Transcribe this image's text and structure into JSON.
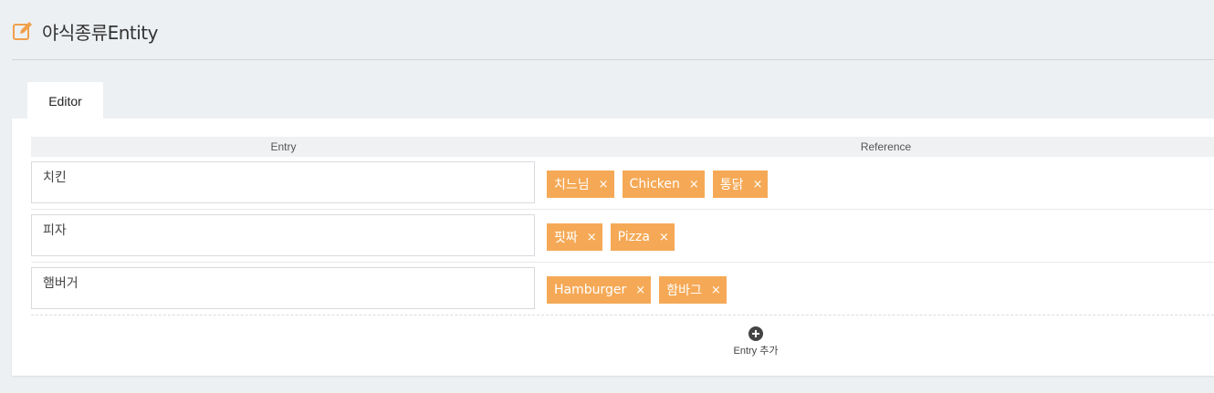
{
  "header": {
    "title": "야식종류Entity",
    "icon": "edit-icon"
  },
  "tabs": [
    {
      "label": "Editor"
    }
  ],
  "table": {
    "columns": {
      "entry": "Entry",
      "reference": "Reference"
    },
    "rows": [
      {
        "entry": "치킨",
        "references": [
          "치느님",
          "Chicken",
          "통닭"
        ]
      },
      {
        "entry": "피자",
        "references": [
          "핏짜",
          "Pizza"
        ]
      },
      {
        "entry": "햄버거",
        "references": [
          "Hamburger",
          "함바그"
        ]
      }
    ]
  },
  "add_entry": {
    "label": "Entry 추가",
    "icon": "plus-circle-icon"
  },
  "tag_remove_glyph": "×",
  "colors": {
    "tag": "#f5a956",
    "accent": "#f0a04b",
    "background": "#edf0f3"
  }
}
